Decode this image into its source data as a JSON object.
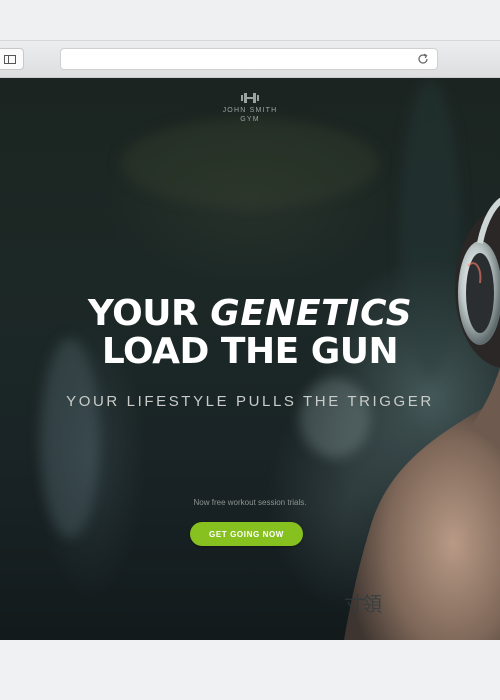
{
  "browser": {
    "address_bar": {
      "value": "",
      "placeholder": ""
    },
    "icons": {
      "sidebar": "sidebar-toggle-icon",
      "reload": "reload-icon"
    }
  },
  "site": {
    "logo": {
      "icon": "dumbbell-icon",
      "line1": "JOHN SMITH",
      "line2": "GYM"
    },
    "hero": {
      "headline_word1": "YOUR",
      "headline_word2": "GENETICS",
      "headline_line2": "LOAD THE GUN",
      "subheadline": "YOUR LIFESTYLE PULLS THE TRIGGER",
      "promo_text": "Now free workout session trials.",
      "cta_label": "GET GOING NOW"
    }
  },
  "colors": {
    "accent": "#86c11f",
    "hero_text": "#ffffff",
    "subheadline_text": "#c9ccc8",
    "browser_chrome": "#f0f1f3"
  }
}
